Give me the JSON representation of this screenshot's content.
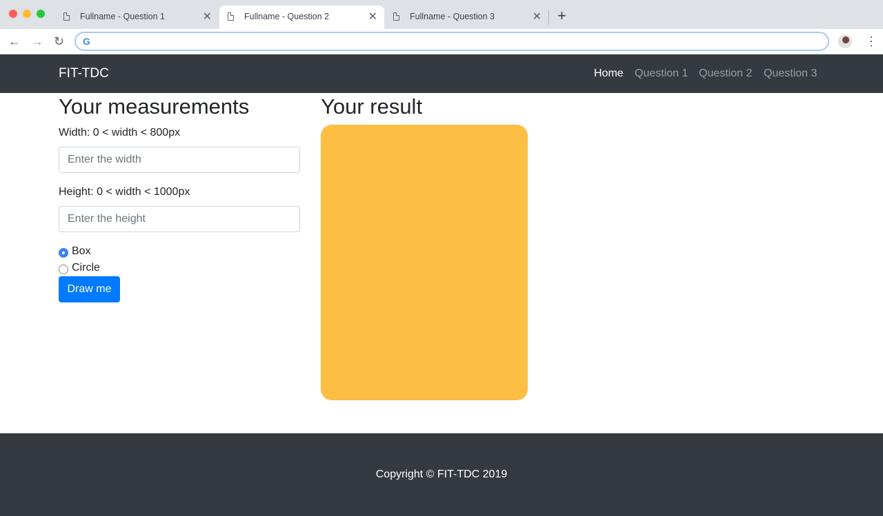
{
  "browser": {
    "tabs": [
      {
        "title": "Fullname - Question 1",
        "active": false
      },
      {
        "title": "Fullname - Question 2",
        "active": true
      },
      {
        "title": "Fullname - Question 3",
        "active": false
      }
    ],
    "new_tab_symbol": "+",
    "close_symbol": "✕",
    "url": "",
    "icons": {
      "back": "←",
      "forward": "→",
      "reload": "↻",
      "menu": "⋮",
      "omnibox": "G"
    }
  },
  "navbar": {
    "brand": "FIT-TDC",
    "links": [
      "Home",
      "Question 1",
      "Question 2",
      "Question 3"
    ],
    "active_link": "Home"
  },
  "form": {
    "heading": "Your measurements",
    "width_label": "Width: 0 < width < 800px",
    "width_placeholder": "Enter the width",
    "width_value": "",
    "height_label": "Height: 0 < width < 1000px",
    "height_placeholder": "Enter the height",
    "height_value": "",
    "shapes": [
      "Box",
      "Circle"
    ],
    "selected_shape": "Box",
    "submit_label": "Draw me"
  },
  "result": {
    "heading": "Your result",
    "shape": "Box",
    "color": "#fdbe44"
  },
  "footer": {
    "copyright": "Copyright © FIT-TDC 2019"
  },
  "colors": {
    "navbar_bg": "#343a40",
    "primary": "#007bff",
    "result_fill": "#fdbe44"
  }
}
